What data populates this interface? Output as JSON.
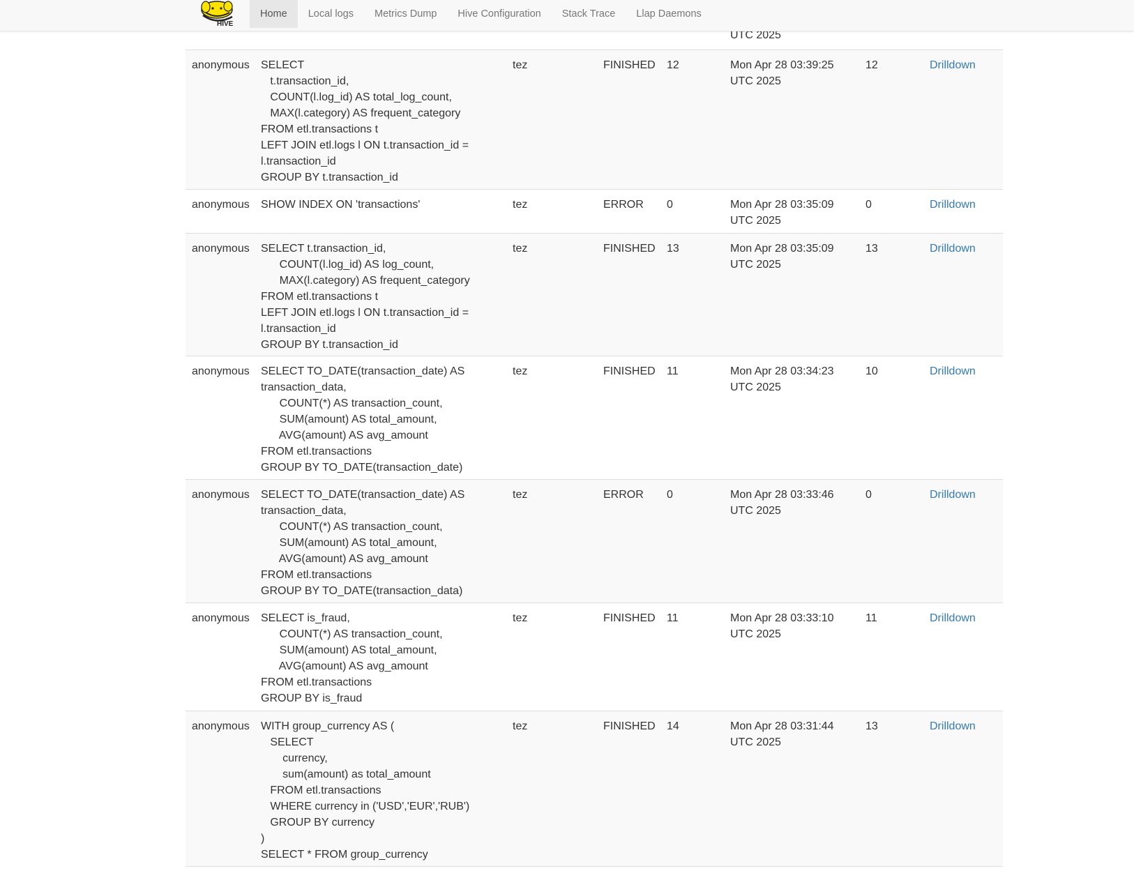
{
  "navbar": {
    "logo_text": "HIVE",
    "items": [
      "Home",
      "Local logs",
      "Metrics Dump",
      "Hive Configuration",
      "Stack Trace",
      "Llap Daemons"
    ],
    "active": "Home"
  },
  "partial_row": {
    "time_tail": "UTC 2025"
  },
  "rows": [
    {
      "user": "anonymous",
      "query": "SELECT\n   t.transaction_id,\n   COUNT(l.log_id) AS total_log_count,\n   MAX(l.category) AS frequent_category\nFROM etl.transactions t\nLEFT JOIN etl.logs l ON t.transaction_id =\nl.transaction_id\nGROUP BY t.transaction_id",
      "engine": "tez",
      "state": "FINISHED",
      "latency": "12",
      "time": "Mon Apr 28 03:39:25\nUTC 2025",
      "id": "12",
      "link": "Drilldown"
    },
    {
      "user": "anonymous",
      "query": "SHOW INDEX ON 'transactions'",
      "engine": "tez",
      "state": "ERROR",
      "latency": "0",
      "time": "Mon Apr 28 03:35:09\nUTC 2025",
      "id": "0",
      "link": "Drilldown"
    },
    {
      "user": "anonymous",
      "query": "SELECT t.transaction_id,\n      COUNT(l.log_id) AS log_count,\n      MAX(l.category) AS frequent_category\nFROM etl.transactions t\nLEFT JOIN etl.logs l ON t.transaction_id =\nl.transaction_id\nGROUP BY t.transaction_id",
      "engine": "tez",
      "state": "FINISHED",
      "latency": "13",
      "time": "Mon Apr 28 03:35:09\nUTC 2025",
      "id": "13",
      "link": "Drilldown"
    },
    {
      "user": "anonymous",
      "query": "SELECT TO_DATE(transaction_date) AS\ntransaction_data,\n      COUNT(*) AS transaction_count,\n      SUM(amount) AS total_amount,\n      AVG(amount) AS avg_amount\nFROM etl.transactions\nGROUP BY TO_DATE(transaction_date)",
      "engine": "tez",
      "state": "FINISHED",
      "latency": "11",
      "time": "Mon Apr 28 03:34:23\nUTC 2025",
      "id": "10",
      "link": "Drilldown"
    },
    {
      "user": "anonymous",
      "query": "SELECT TO_DATE(transaction_date) AS\ntransaction_data,\n      COUNT(*) AS transaction_count,\n      SUM(amount) AS total_amount,\n      AVG(amount) AS avg_amount\nFROM etl.transactions\nGROUP BY TO_DATE(transaction_data)",
      "engine": "tez",
      "state": "ERROR",
      "latency": "0",
      "time": "Mon Apr 28 03:33:46\nUTC 2025",
      "id": "0",
      "link": "Drilldown"
    },
    {
      "user": "anonymous",
      "query": "SELECT is_fraud,\n      COUNT(*) AS transaction_count,\n      SUM(amount) AS total_amount,\n      AVG(amount) AS avg_amount\nFROM etl.transactions\nGROUP BY is_fraud",
      "engine": "tez",
      "state": "FINISHED",
      "latency": "11",
      "time": "Mon Apr 28 03:33:10\nUTC 2025",
      "id": "11",
      "link": "Drilldown"
    },
    {
      "user": "anonymous",
      "query": "WITH group_currency AS (\n   SELECT\n       currency,\n       sum(amount) as total_amount\n   FROM etl.transactions\n   WHERE currency in ('USD','EUR','RUB')\n   GROUP BY currency\n)\nSELECT * FROM group_currency",
      "engine": "tez",
      "state": "FINISHED",
      "latency": "14",
      "time": "Mon Apr 28 03:31:44\nUTC 2025",
      "id": "13",
      "link": "Drilldown"
    }
  ]
}
